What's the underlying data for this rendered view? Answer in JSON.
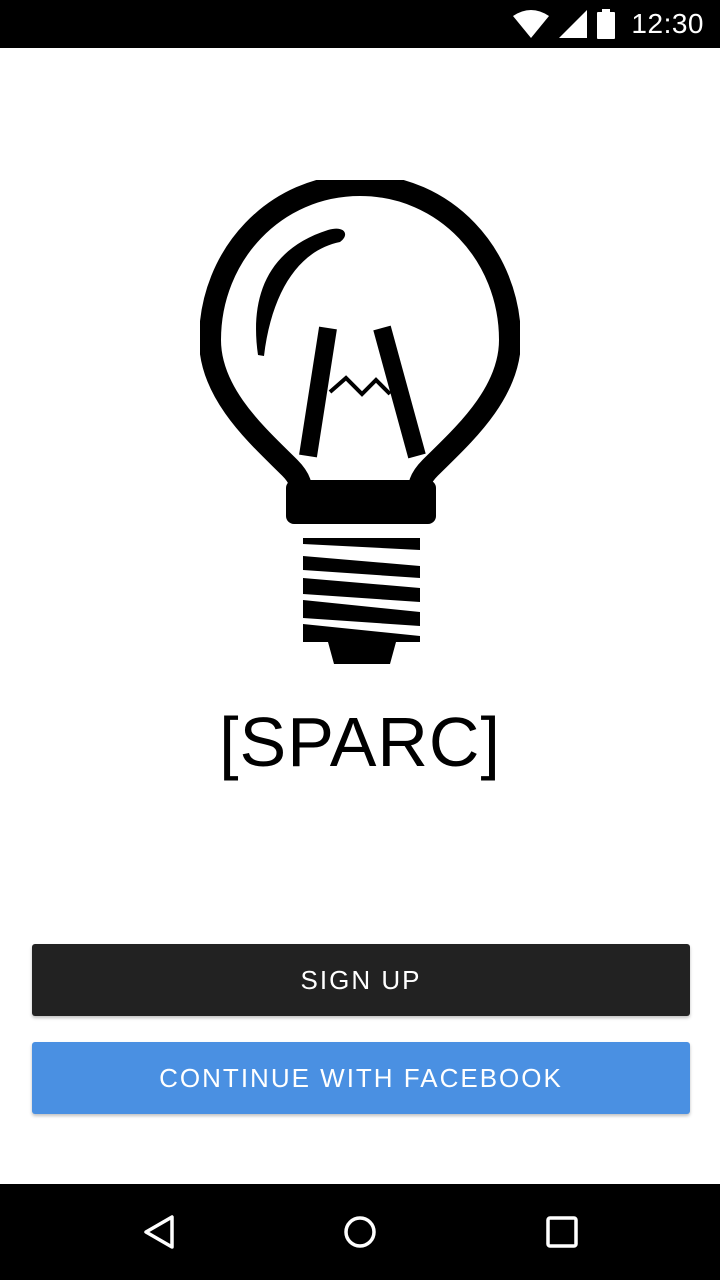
{
  "status_bar": {
    "time": "12:30",
    "icons": [
      "wifi-icon",
      "signal-icon",
      "battery-icon"
    ]
  },
  "logo": {
    "icon": "lightbulb-icon",
    "brand_name": "[SPARC]"
  },
  "buttons": {
    "signup_label": "SIGN UP",
    "facebook_label": "CONTINUE WITH FACEBOOK"
  },
  "colors": {
    "signup_bg": "#222222",
    "facebook_bg": "#4a90e2",
    "status_bar_bg": "#000000",
    "nav_bar_bg": "#000000"
  },
  "nav_bar": {
    "icons": [
      "back-icon",
      "home-icon",
      "recents-icon"
    ]
  }
}
